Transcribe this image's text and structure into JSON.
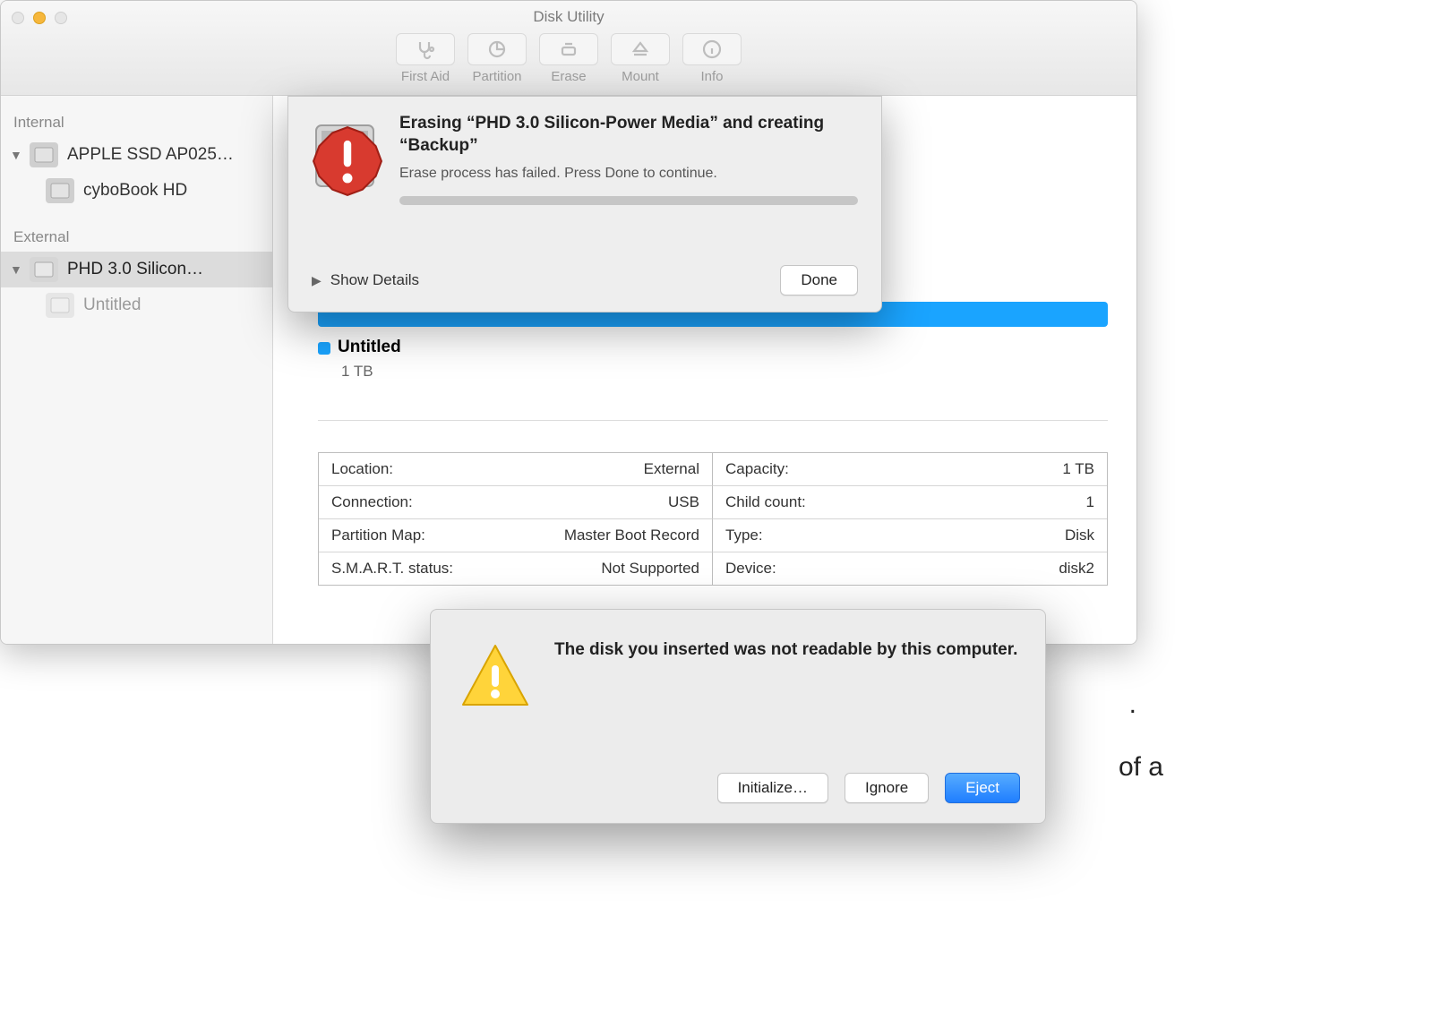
{
  "window": {
    "title": "Disk Utility",
    "toolbar": {
      "first_aid": "First Aid",
      "partition": "Partition",
      "erase": "Erase",
      "mount": "Mount",
      "info": "Info"
    }
  },
  "sidebar": {
    "section_internal": "Internal",
    "section_external": "External",
    "items": [
      {
        "label": "APPLE SSD AP025…"
      },
      {
        "label": "cyboBook HD"
      },
      {
        "label": "PHD 3.0 Silicon…"
      },
      {
        "label": "Untitled"
      }
    ]
  },
  "volume": {
    "name": "Untitled",
    "size": "1 TB"
  },
  "info": {
    "left": [
      {
        "k": "Location:",
        "v": "External"
      },
      {
        "k": "Connection:",
        "v": "USB"
      },
      {
        "k": "Partition Map:",
        "v": "Master Boot Record"
      },
      {
        "k": "S.M.A.R.T. status:",
        "v": "Not Supported"
      }
    ],
    "right": [
      {
        "k": "Capacity:",
        "v": "1 TB"
      },
      {
        "k": "Child count:",
        "v": "1"
      },
      {
        "k": "Type:",
        "v": "Disk"
      },
      {
        "k": "Device:",
        "v": "disk2"
      }
    ]
  },
  "sheet": {
    "title": "Erasing “PHD 3.0 Silicon-Power Media” and creating “Backup”",
    "message": "Erase process has failed. Press Done to continue.",
    "show_details": "Show Details",
    "done": "Done"
  },
  "alert": {
    "message": "The disk you inserted was not readable by this computer.",
    "initialize": "Initialize…",
    "ignore": "Ignore",
    "eject": "Eject"
  },
  "bg": {
    "frag1": ".",
    "frag2": "of a"
  }
}
